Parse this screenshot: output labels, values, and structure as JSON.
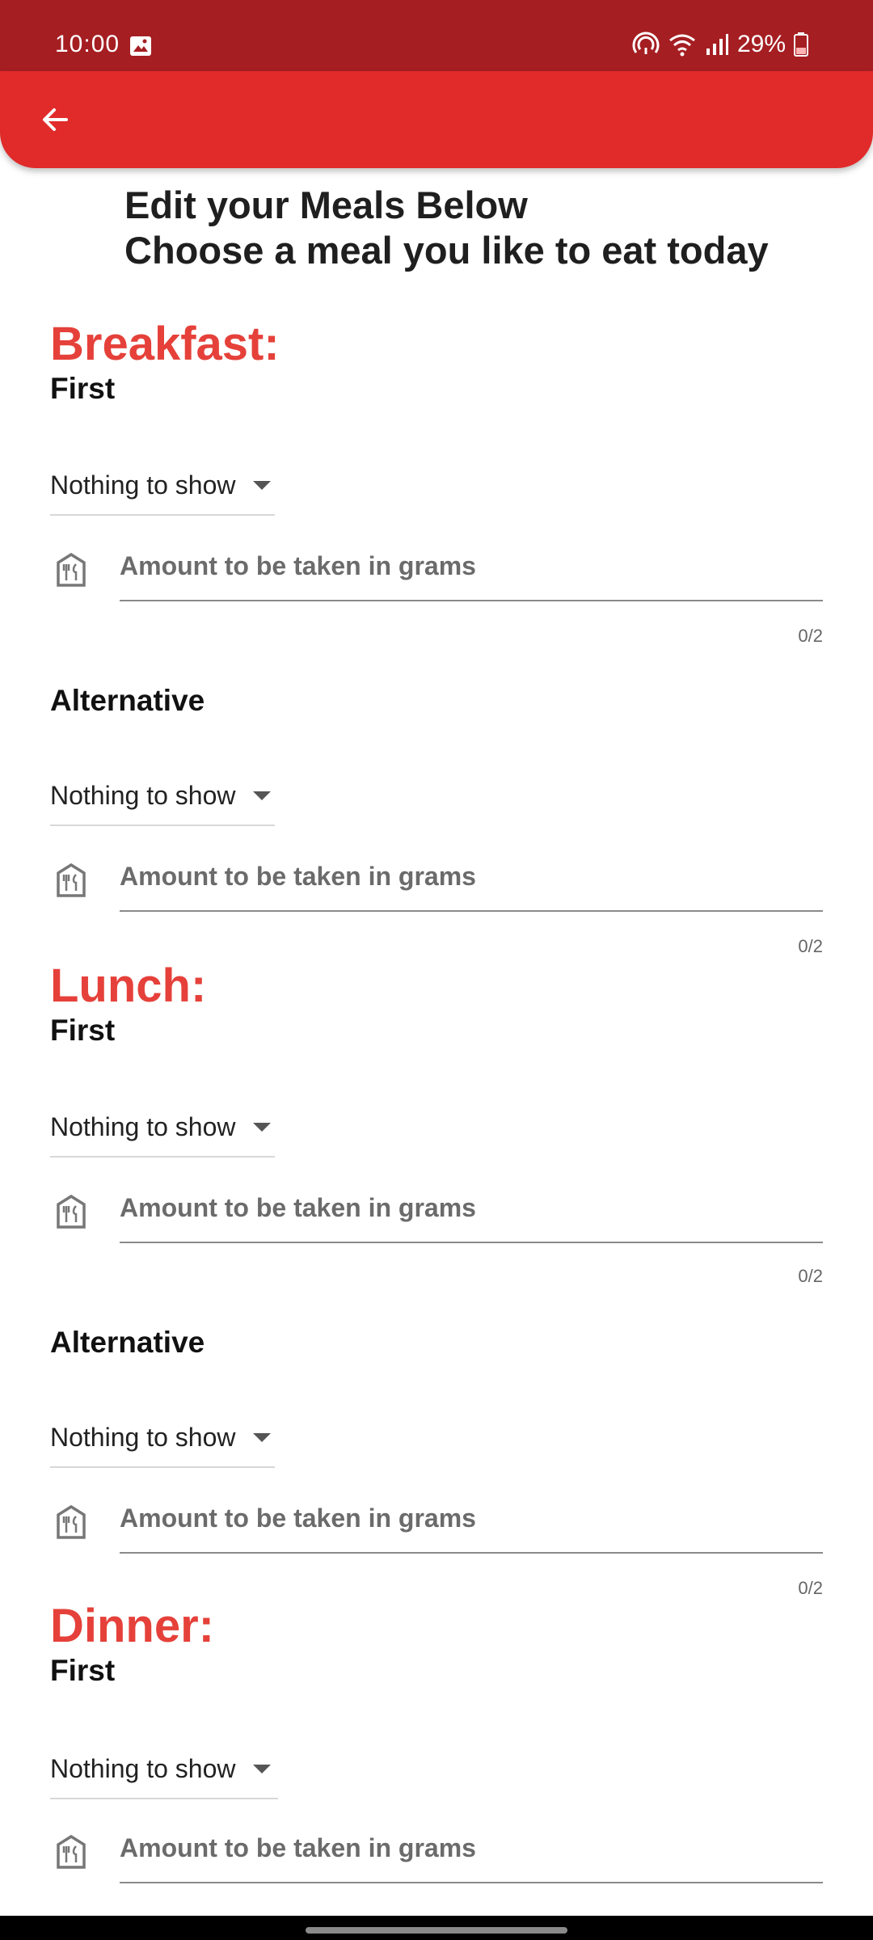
{
  "status_bar": {
    "time": "10:00",
    "battery": "29%"
  },
  "heading": {
    "line1": "Edit your Meals Below",
    "line2": "Choose a meal you like to eat today"
  },
  "sections": [
    {
      "meal": "Breakfast:",
      "entries": [
        {
          "slot": "First",
          "dropdown": "Nothing to show",
          "placeholder": "Amount to be taken in grams",
          "counter": "0/2"
        },
        {
          "slot": "Alternative",
          "dropdown": "Nothing to show",
          "placeholder": "Amount to be taken in grams",
          "counter": "0/2"
        }
      ]
    },
    {
      "meal": "Lunch:",
      "entries": [
        {
          "slot": "First",
          "dropdown": "Nothing to show",
          "placeholder": "Amount to be taken in grams",
          "counter": "0/2"
        },
        {
          "slot": "Alternative",
          "dropdown": "Nothing to show",
          "placeholder": "Amount to be taken in grams",
          "counter": "0/2"
        }
      ]
    },
    {
      "meal": "Dinner:",
      "entries": [
        {
          "slot": "First",
          "dropdown": "Nothing to show",
          "placeholder": "Amount to be taken in grams"
        }
      ]
    }
  ],
  "colors": {
    "status_bar": "#a51e22",
    "app_bar": "#e12a2a",
    "meal_title": "#e5413a"
  },
  "icons": {
    "back": "arrow-left-icon",
    "amount": "restaurant-menu-icon"
  }
}
